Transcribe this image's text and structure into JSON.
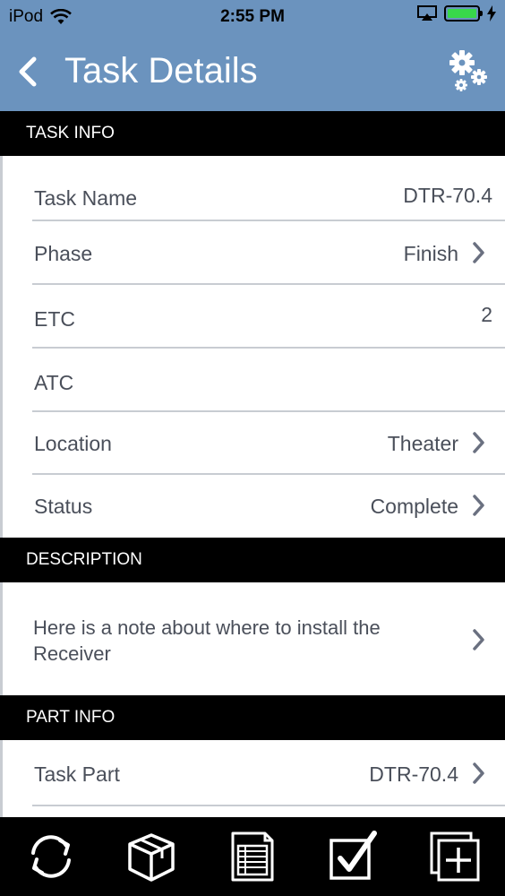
{
  "status_bar": {
    "carrier": "iPod",
    "time": "2:55 PM",
    "icons": [
      "wifi-icon",
      "airplay-icon",
      "battery-icon",
      "charging-bolt-icon"
    ],
    "battery_color": "#38d84a"
  },
  "nav": {
    "title": "Task Details",
    "back_icon": "chevron-left-icon",
    "settings_icon": "gears-icon",
    "bar_color": "#6b93be"
  },
  "task_info": {
    "header": "TASK INFO",
    "rows": [
      {
        "label": "Task Name",
        "value": "DTR-70.4"
      },
      {
        "label": "Phase",
        "value": "Finish"
      },
      {
        "label": "ETC",
        "value": "2"
      },
      {
        "label": "ATC",
        "value": ""
      },
      {
        "label": "Location",
        "value": "Theater"
      },
      {
        "label": "Status",
        "value": "Complete"
      }
    ]
  },
  "description": {
    "header": "DESCRIPTION",
    "text_line1": "Here is a note about where to install the",
    "text_line2": "Receiver"
  },
  "part_info": {
    "header": "PART INFO",
    "rows": [
      {
        "label": "Task Part",
        "value": "DTR-70.4"
      }
    ]
  },
  "tab_bar": {
    "items": [
      "sync-icon",
      "package-icon",
      "list-document-icon",
      "checkbox-icon",
      "add-copy-icon"
    ]
  }
}
